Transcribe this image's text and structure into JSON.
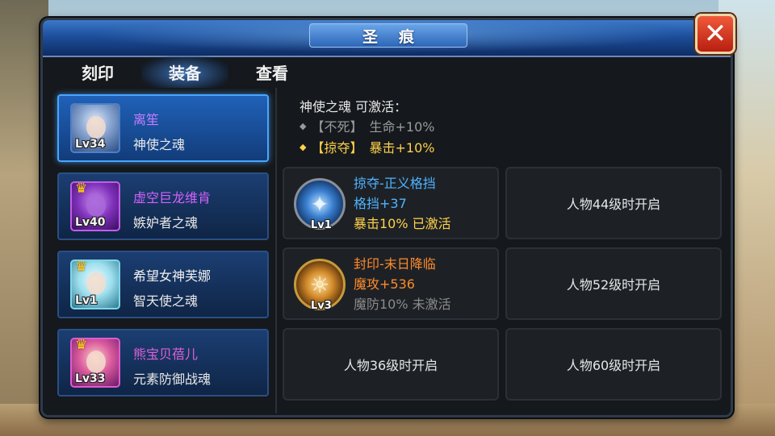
{
  "window": {
    "title": "圣痕",
    "close_symbol": "✕"
  },
  "tabs": [
    {
      "label": "刻印",
      "active": false
    },
    {
      "label": "装备",
      "active": true
    },
    {
      "label": "查看",
      "active": false
    }
  ],
  "heroes": [
    {
      "name": "离笙",
      "soul": "神使之魂",
      "level": "Lv34",
      "name_color": "#c77dff",
      "frame": "blue",
      "crown": false,
      "selected": true
    },
    {
      "name": "虚空巨龙维肯",
      "soul": "嫉妒者之魂",
      "level": "Lv40",
      "name_color": "#d562ff",
      "frame": "purple",
      "crown": true,
      "selected": false
    },
    {
      "name": "希望女神芙娜",
      "soul": "智天使之魂",
      "level": "Lv1",
      "name_color": "#f0f0f0",
      "frame": "cyan",
      "crown": true,
      "selected": false
    },
    {
      "name": "熊宝贝蓓儿",
      "soul": "元素防御战魂",
      "level": "Lv33",
      "name_color": "#e060d8",
      "frame": "pink",
      "crown": true,
      "selected": false
    }
  ],
  "activation": {
    "title": "神使之魂 可激活：",
    "lines": [
      {
        "bracket": "【不死】",
        "effect": "生命+10%",
        "color": "#9a9a9a",
        "icon": "diamond-arrow-icon"
      },
      {
        "bracket": "【掠夺】",
        "effect": "暴击+10%",
        "color": "#ffd24a",
        "icon": "diamond-arrow-icon"
      }
    ]
  },
  "slots": [
    {
      "type": "skill",
      "icon": "shield-rune-icon",
      "icon_style": "blue",
      "level": "Lv1",
      "name": "掠夺-正义格挡",
      "name_color": "#4fb4ff",
      "stat": "格挡+37",
      "stat_color": "#4fb4ff",
      "bonus": "暴击10% 已激活",
      "bonus_color": "#ffd24a"
    },
    {
      "type": "locked",
      "text": "人物44级时开启"
    },
    {
      "type": "skill",
      "icon": "flame-rune-icon",
      "icon_style": "gold",
      "level": "Lv3",
      "name": "封印-末日降临",
      "name_color": "#ff8a2a",
      "stat": "魔攻+536",
      "stat_color": "#ff8a2a",
      "bonus": "魔防10% 未激活",
      "bonus_color": "#8a8a8a"
    },
    {
      "type": "locked",
      "text": "人物52级时开启"
    },
    {
      "type": "locked",
      "text": "人物36级时开启"
    },
    {
      "type": "locked",
      "text": "人物60级时开启"
    }
  ]
}
